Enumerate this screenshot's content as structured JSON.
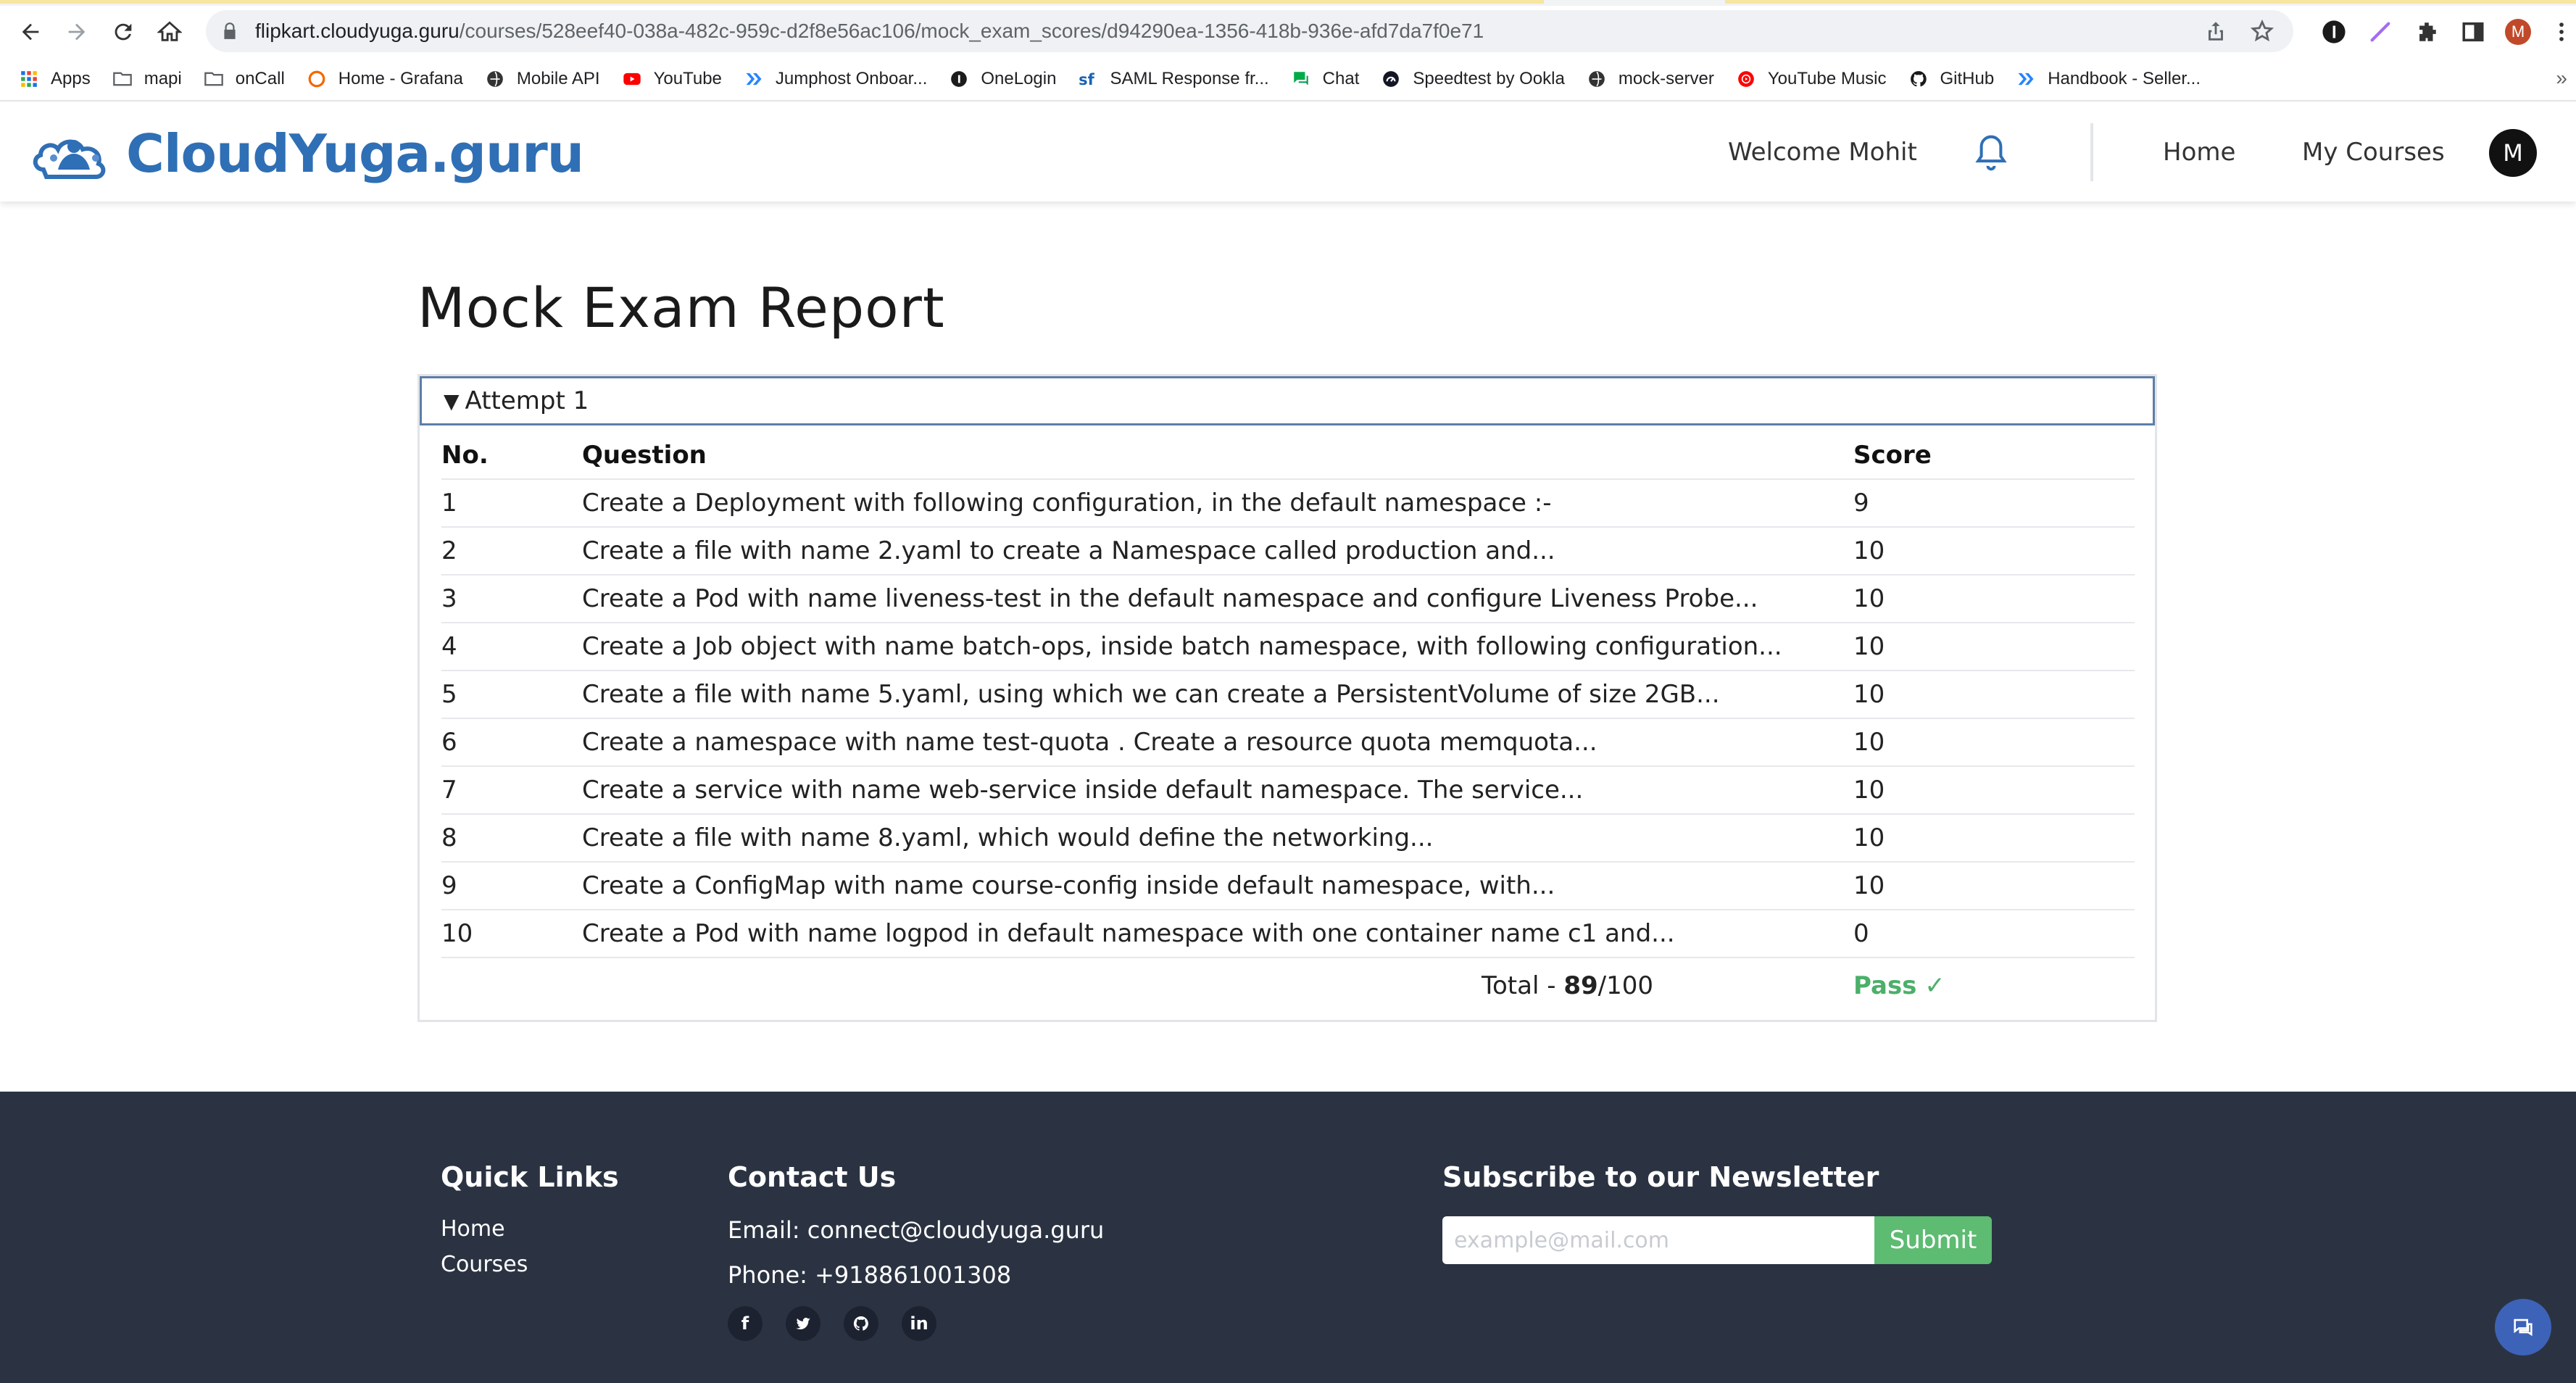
{
  "browser": {
    "url_host": "flipkart.cloudyuga.guru",
    "url_path": "/courses/528eef40-038a-482c-959c-d2f8e56ac106/mock_exam_scores/d94290ea-1356-418b-936e-afd7da7f0e71",
    "bookmarks": [
      {
        "label": "Apps",
        "icon": "apps-grid-icon"
      },
      {
        "label": "mapi",
        "icon": "folder-icon"
      },
      {
        "label": "onCall",
        "icon": "folder-icon"
      },
      {
        "label": "Home - Grafana",
        "icon": "grafana-icon"
      },
      {
        "label": "Mobile API",
        "icon": "globe-icon"
      },
      {
        "label": "YouTube",
        "icon": "youtube-icon"
      },
      {
        "label": "Jumphost Onboar...",
        "icon": "confluence-icon"
      },
      {
        "label": "OneLogin",
        "icon": "onelogin-icon"
      },
      {
        "label": "SAML Response fr...",
        "icon": "sf-icon"
      },
      {
        "label": "Chat",
        "icon": "chat-icon"
      },
      {
        "label": "Speedtest by Ookla",
        "icon": "speedtest-icon"
      },
      {
        "label": "mock-server",
        "icon": "globe-icon"
      },
      {
        "label": "YouTube Music",
        "icon": "youtube-music-icon"
      },
      {
        "label": "GitHub",
        "icon": "github-icon"
      },
      {
        "label": "Handbook - Seller...",
        "icon": "confluence-icon"
      }
    ],
    "more": "»",
    "profile_initial": "M"
  },
  "header": {
    "logo_text": "CloudYuga.guru",
    "welcome": "Welcome Mohit",
    "nav": {
      "home": "Home",
      "my_courses": "My Courses"
    },
    "avatar_initial": "M"
  },
  "main": {
    "title": "Mock Exam Report",
    "attempt_label": "Attempt 1",
    "columns": {
      "no": "No.",
      "question": "Question",
      "score": "Score"
    },
    "rows": [
      {
        "no": "1",
        "question": "Create a Deployment with following configuration, in the default namespace :-",
        "score": "9"
      },
      {
        "no": "2",
        "question": "Create a file with name 2.yaml to create a Namespace called production and...",
        "score": "10"
      },
      {
        "no": "3",
        "question": "Create a Pod with name liveness-test in the default namespace and configure Liveness Probe...",
        "score": "10"
      },
      {
        "no": "4",
        "question": "Create a Job object with name batch-ops, inside batch namespace, with following configuration...",
        "score": "10"
      },
      {
        "no": "5",
        "question": "Create a file with name 5.yaml, using which we can create a PersistentVolume of size 2GB...",
        "score": "10"
      },
      {
        "no": "6",
        "question": "Create a namespace with name test-quota . Create a resource quota memquota...",
        "score": "10"
      },
      {
        "no": "7",
        "question": "Create a service with name web-service inside default namespace. The service...",
        "score": "10"
      },
      {
        "no": "8",
        "question": "Create a file with name 8.yaml, which would define the networking...",
        "score": "10"
      },
      {
        "no": "9",
        "question": "Create a ConfigMap with name course-config inside default namespace, with...",
        "score": "10"
      },
      {
        "no": "10",
        "question": "Create a Pod with name logpod in default namespace with one container name c1 and...",
        "score": "0"
      }
    ],
    "total_label": "Total - ",
    "total_score": "89",
    "total_max": "/100",
    "result": "Pass",
    "result_mark": "✓"
  },
  "footer": {
    "quick_links_heading": "Quick Links",
    "quick_links": [
      "Home",
      "Courses"
    ],
    "contact_heading": "Contact Us",
    "email_line": "Email: connect@cloudyuga.guru",
    "phone_line": "Phone: +918861001308",
    "social": [
      "facebook-icon",
      "twitter-icon",
      "github-icon",
      "linkedin-icon"
    ],
    "newsletter_heading": "Subscribe to our Newsletter",
    "newsletter_placeholder": "example@mail.com",
    "submit_label": "Submit"
  },
  "colors": {
    "accent_green": "#5dbb72",
    "footer_bg": "#2b3342",
    "logo_blue": "#2f6fb5"
  }
}
